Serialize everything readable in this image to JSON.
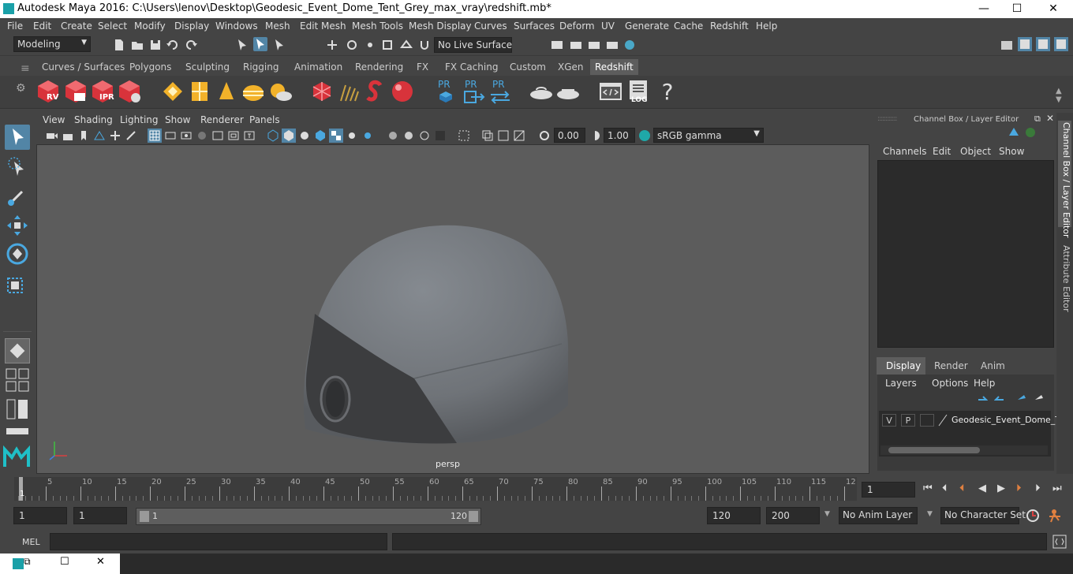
{
  "window": {
    "title": "Autodesk Maya 2016: C:\\Users\\lenov\\Desktop\\Geodesic_Event_Dome_Tent_Grey_max_vray\\redshift.mb*",
    "min": "—",
    "max": "☐",
    "close": "✕"
  },
  "menu": [
    "File",
    "Edit",
    "Create",
    "Select",
    "Modify",
    "Display",
    "Windows",
    "Mesh",
    "Edit Mesh",
    "Mesh Tools",
    "Mesh Display",
    "Curves",
    "Surfaces",
    "Deform",
    "UV",
    "Generate",
    "Cache",
    "Redshift",
    "Help"
  ],
  "status": {
    "mode": "Modeling",
    "live_surface": "No Live Surface"
  },
  "shelf_tabs": [
    "Curves / Surfaces",
    "Polygons",
    "Sculpting",
    "Rigging",
    "Animation",
    "Rendering",
    "FX",
    "FX Caching",
    "Custom",
    "XGen",
    "Redshift"
  ],
  "shelf_active": "Redshift",
  "shelf_labels": {
    "rv": "RV",
    "ipr": "IPR",
    "pr": "PR",
    "log": "LOG",
    "help": "?"
  },
  "panel_menu": [
    "View",
    "Shading",
    "Lighting",
    "Show",
    "Renderer",
    "Panels"
  ],
  "panel_tools": {
    "exposure": "0.00",
    "gamma": "1.00",
    "color_space": "sRGB gamma"
  },
  "viewport": {
    "camera": "persp"
  },
  "channel_box": {
    "title": "Channel Box / Layer Editor",
    "menu": [
      "Channels",
      "Edit",
      "Object",
      "Show"
    ],
    "tabs": [
      "Display",
      "Render",
      "Anim"
    ],
    "active_tab": "Display",
    "layer_menu": [
      "Layers",
      "Options",
      "Help"
    ],
    "layer": {
      "v": "V",
      "p": "P",
      "name": "Geodesic_Event_Dome_T"
    }
  },
  "side_tabs": [
    "Channel Box / Layer Editor",
    "Attribute Editor"
  ],
  "timeline": {
    "ticks": [
      "5",
      "10",
      "15",
      "20",
      "25",
      "30",
      "35",
      "40",
      "45",
      "50",
      "55",
      "60",
      "65",
      "70",
      "75",
      "80",
      "85",
      "90",
      "95",
      "100",
      "105",
      "110",
      "115",
      "12"
    ],
    "first": "1",
    "current_frame": "1"
  },
  "range": {
    "start": "1",
    "playback_start": "1",
    "slider_start": "1",
    "slider_end": "120",
    "playback_end": "120",
    "end": "200",
    "anim_layer": "No Anim Layer",
    "char_set": "No Character Set"
  },
  "cmd": {
    "label": "MEL"
  },
  "colors": {
    "bg": "#444444",
    "viewport": "#5c5c5c",
    "accent": "#5285a6",
    "redshift_red": "#d8333b"
  }
}
